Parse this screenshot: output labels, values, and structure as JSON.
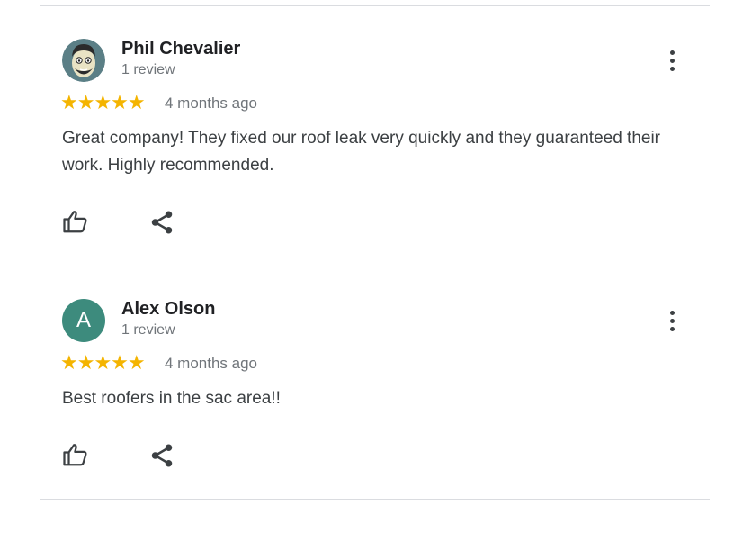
{
  "reviews": [
    {
      "name": "Phil Chevalier",
      "review_count": "1 review",
      "rating": 5,
      "stars": "★★★★★",
      "age": "4 months ago",
      "text": "Great company! They fixed our roof leak very quickly and they guaranteed their work. Highly recommended.",
      "avatar_type": "cartoon-portrait",
      "more_icon": "more-vert-icon",
      "like_icon": "thumb-up-icon",
      "share_icon": "share-icon"
    },
    {
      "name": "Alex Olson",
      "review_count": "1 review",
      "rating": 5,
      "stars": "★★★★★",
      "age": "4 months ago",
      "text": "Best roofers in the sac area!!",
      "avatar_letter": "A",
      "avatar_color": "#3d8b7d",
      "more_icon": "more-vert-icon",
      "like_icon": "thumb-up-icon",
      "share_icon": "share-icon"
    }
  ],
  "colors": {
    "star": "#f4b400",
    "divider": "#dadce0",
    "text": "#3c4043",
    "secondary": "#70757a"
  }
}
